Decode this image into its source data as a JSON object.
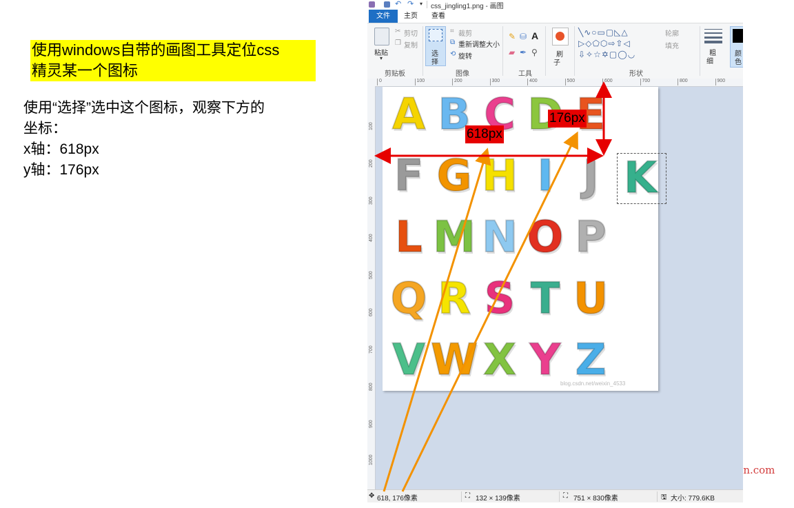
{
  "slide": {
    "heading_line1": "使用windows自带的画图工具定位css",
    "heading_line2": "精灵某一个图标",
    "desc_line1": "使用“选择”选中这个图标，观察下方的",
    "desc_line2": "坐标：",
    "desc_line3": "x轴：618px",
    "desc_line4": "y轴：176px",
    "watermark": "Yuucn.com"
  },
  "paint": {
    "title": "css_jingling1.png - 画图",
    "tabs": [
      "文件",
      "主页",
      "查看"
    ],
    "clipboard": {
      "paste": "粘贴",
      "cut": "剪切",
      "copy": "复制",
      "label": "剪贴板"
    },
    "image": {
      "select": "选",
      "select2": "择",
      "crop": "裁剪",
      "resize": "重新调整大小",
      "rotate": "旋转",
      "label": "图像"
    },
    "tools": {
      "label": "工具",
      "text_tool": "A"
    },
    "brushes": {
      "label1": "刷",
      "label2": "子"
    },
    "shapes": {
      "outline": "轮廓",
      "fill": "填充",
      "label": "形状"
    },
    "size": {
      "label1": "粗",
      "label2": "细"
    },
    "colors": {
      "label1": "颜",
      "label2": "色"
    },
    "ruler_h": [
      "0",
      "100",
      "200",
      "300",
      "400",
      "500",
      "600",
      "700",
      "800",
      "900"
    ],
    "ruler_v": [
      "100",
      "200",
      "300",
      "400",
      "500",
      "600",
      "700",
      "800",
      "900",
      "1000"
    ],
    "letters": [
      {
        "char": "A",
        "color": "#f5d400"
      },
      {
        "char": "B",
        "color": "#6ab8f0"
      },
      {
        "char": "C",
        "color": "#ea3f8e"
      },
      {
        "char": "D",
        "color": "#8cc63e"
      },
      {
        "char": "E",
        "color": "#e8541e"
      },
      {
        "char": "F",
        "color": "#9a9a9a"
      },
      {
        "char": "G",
        "color": "#f29400"
      },
      {
        "char": "H",
        "color": "#f5e000"
      },
      {
        "char": "I",
        "color": "#5fb8f0"
      },
      {
        "char": "J",
        "color": "#a8a8a8"
      },
      {
        "char": "K",
        "color": "#36b08c"
      },
      {
        "char": "L",
        "color": "#e6500f"
      },
      {
        "char": "M",
        "color": "#7cc243"
      },
      {
        "char": "N",
        "color": "#8ec9f0"
      },
      {
        "char": "O",
        "color": "#e23020"
      },
      {
        "char": "P",
        "color": "#b0b0b0"
      },
      {
        "char": "Q",
        "color": "#f5a623"
      },
      {
        "char": "R",
        "color": "#f5e400"
      },
      {
        "char": "S",
        "color": "#e8317c"
      },
      {
        "char": "T",
        "color": "#3aae8e"
      },
      {
        "char": "U",
        "color": "#f39200"
      },
      {
        "char": "V",
        "color": "#4cbf8a"
      },
      {
        "char": "W",
        "color": "#f39a00"
      },
      {
        "char": "X",
        "color": "#82c341"
      },
      {
        "char": "Y",
        "color": "#ea3f8e"
      },
      {
        "char": "Z",
        "color": "#4aaee8"
      }
    ],
    "status": {
      "cursor": "618, 176像素",
      "selection": "132 × 139像素",
      "image_size": "751 × 830像素",
      "file_size": "大小: 779.6KB"
    }
  },
  "annotations": {
    "x_label": "618px",
    "y_label": "176px",
    "arrow_color": "#f39200",
    "measure_color": "#e60000"
  }
}
